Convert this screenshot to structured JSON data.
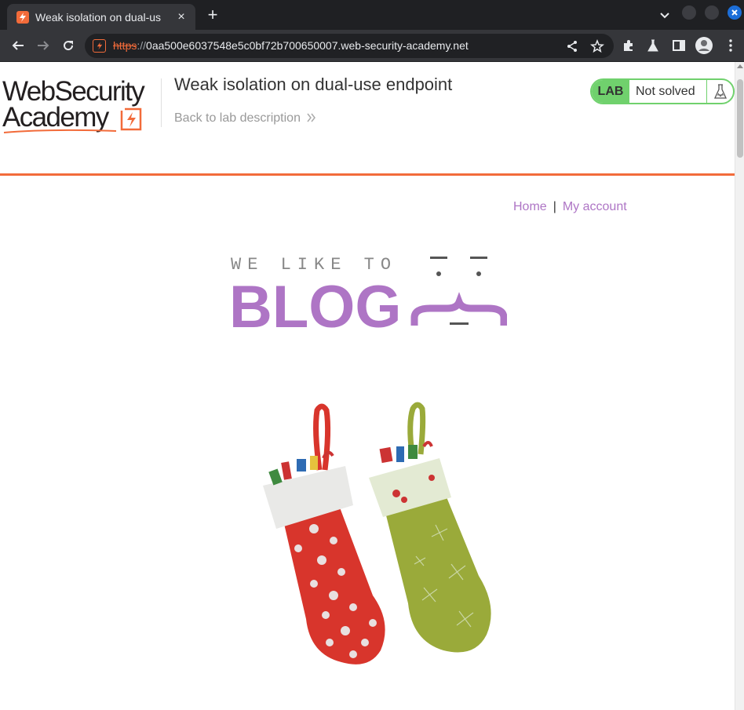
{
  "browser": {
    "tab_title": "Weak isolation on dual-us",
    "url_scheme": "https",
    "url_sep": "://",
    "url_host": "0aa500e6037548e5c0bf72b700650007.web-security-academy.net"
  },
  "lab": {
    "logo_line1": "WebSecurity",
    "logo_line2": "Academy",
    "title": "Weak isolation on dual-use endpoint",
    "back_link": "Back to lab description",
    "badge": "LAB",
    "status": "Not solved"
  },
  "nav": {
    "home": "Home",
    "separator": "|",
    "account": "My account"
  },
  "banner": {
    "tagline": "WE LIKE TO",
    "word": "BLOG"
  },
  "colors": {
    "accent": "#f26b3a",
    "lab_green": "#70d16d",
    "blog_purple": "#ae75c5",
    "stocking_red": "#d8352c",
    "stocking_green": "#9aaa3a"
  }
}
